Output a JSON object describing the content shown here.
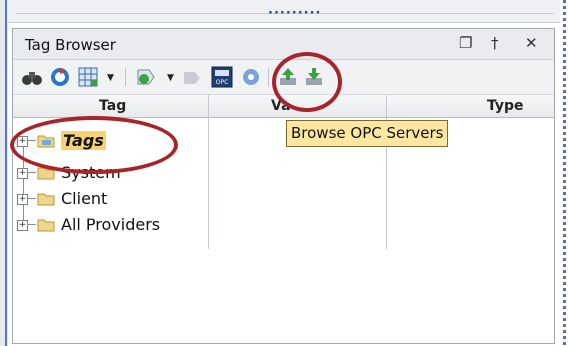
{
  "panel": {
    "title": "Tag Browser",
    "title_buttons": [
      "restore-icon",
      "pin-icon",
      "close-icon"
    ]
  },
  "toolbar": {
    "icons": [
      "binoculars-icon",
      "refresh-icon",
      "grid-icon",
      "dropdown-arrow-icon",
      "add-tag-icon",
      "dropdown-arrow-icon",
      "disabled-icon",
      "browse-opc-servers-icon",
      "settings-icon",
      "import-icon",
      "export-icon"
    ]
  },
  "table": {
    "columns": [
      "Tag",
      "Va",
      "Type"
    ],
    "rows": [
      {
        "label": "Tags",
        "expander": "+"
      },
      {
        "label": "System",
        "expander": "+"
      },
      {
        "label": "Client",
        "expander": "+"
      },
      {
        "label": "All Providers",
        "expander": "+"
      }
    ]
  },
  "tooltip": {
    "text": "Browse OPC Servers"
  },
  "colors": {
    "highlight": "#f6d273",
    "circle": "#a7242a",
    "tooltip_bg": "#ffe7a2"
  }
}
